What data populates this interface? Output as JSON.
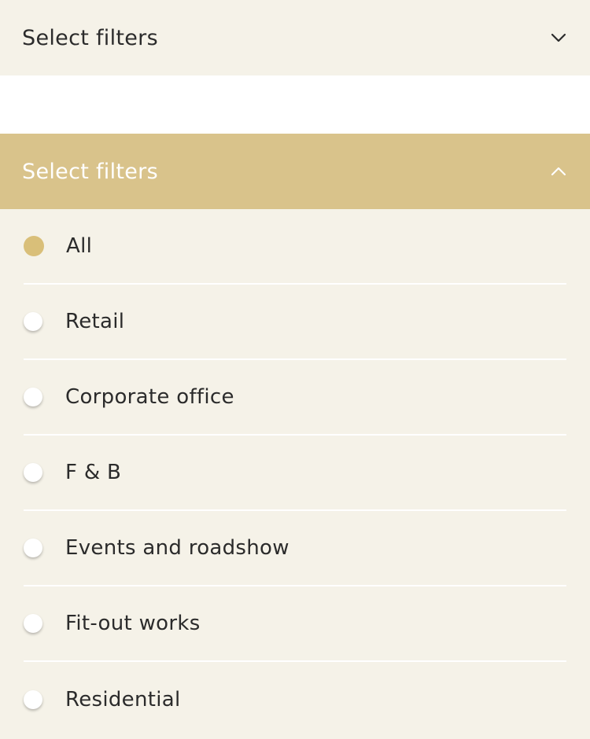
{
  "filter_collapsed": {
    "label": "Select filters",
    "icon": "chevron-down-icon"
  },
  "filter_expanded": {
    "label": "Select filters",
    "icon": "chevron-up-icon",
    "accent_color": "#d9c38b"
  },
  "options": [
    {
      "label": "All",
      "selected": true
    },
    {
      "label": "Retail",
      "selected": false
    },
    {
      "label": "Corporate office",
      "selected": false
    },
    {
      "label": "F & B",
      "selected": false
    },
    {
      "label": "Events and roadshow",
      "selected": false
    },
    {
      "label": "Fit-out works",
      "selected": false
    },
    {
      "label": "Residential",
      "selected": false
    }
  ]
}
